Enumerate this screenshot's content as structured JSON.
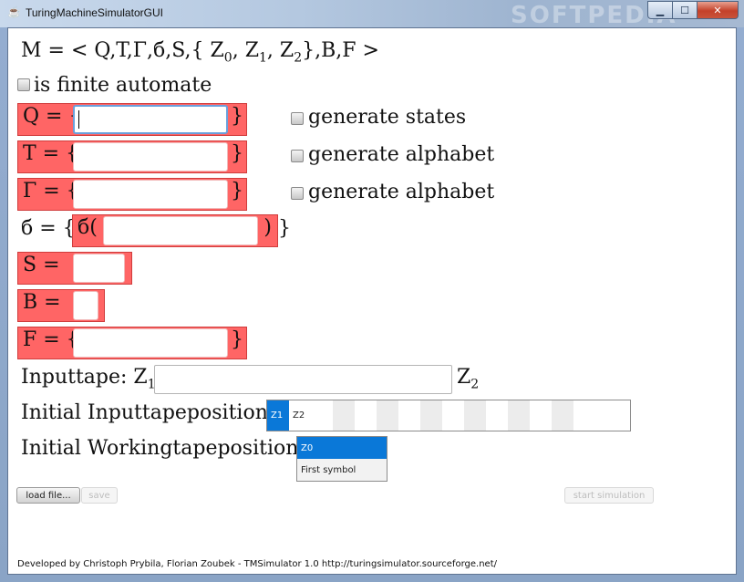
{
  "window": {
    "title": "TuringMachineSimulatorGUI",
    "watermark": "SOFTPEDIA",
    "buttons": {
      "min": "▁",
      "max": "☐",
      "close": "✕"
    }
  },
  "definition": {
    "prefix": "M = < Q,T,Γ,б,S,{ Z",
    "z0_sub": "0",
    "sep1": ", Z",
    "z1_sub": "1",
    "sep2": ", Z",
    "z2_sub": "2",
    "suffix": "},B,F >"
  },
  "finite_automate": {
    "label": "is finite automate",
    "checked": false
  },
  "fields": {
    "q": {
      "label": "Q = {",
      "close": "}",
      "value": ""
    },
    "t": {
      "label": "T = {",
      "close": "}",
      "value": ""
    },
    "gamma": {
      "label": "Γ = {",
      "close": "}",
      "value": ""
    },
    "delta": {
      "outer_open": "б = {",
      "inner_open": "б(",
      "inner_close": ")",
      "outer_close": "}",
      "value": ""
    },
    "s": {
      "label": "S =",
      "value": ""
    },
    "b": {
      "label": "B =",
      "value": ""
    },
    "f": {
      "label": "F = {",
      "close": "}",
      "value": ""
    }
  },
  "generate": {
    "states": {
      "label": "generate states",
      "checked": false
    },
    "alphabet1": {
      "label": "generate alphabet",
      "checked": false
    },
    "alphabet2": {
      "label": "generate alphabet",
      "checked": false
    }
  },
  "inputtape": {
    "label": "Inputtape: Z",
    "left_sub": "1",
    "right": "Z",
    "right_sub": "2",
    "value": ""
  },
  "initial_input": {
    "label": "Initial Inputtapeposition:",
    "cells": [
      "Z1",
      "Z2",
      "",
      "",
      "",
      "",
      "",
      "",
      "",
      ""
    ],
    "selected_index": 0
  },
  "initial_working": {
    "label": "Initial Workingtapeposition:",
    "options": [
      "Z0",
      "First symbol"
    ],
    "selected_index": 0
  },
  "buttons": {
    "load": "load file...",
    "save": "save",
    "start": "start simulation"
  },
  "footer": "Developed by Christoph Prybila, Florian Zoubek - TMSimulator 1.0 http://turingsimulator.sourceforge.net/",
  "colors": {
    "field_bg": "#ff6565",
    "selection": "#0a78d8"
  }
}
